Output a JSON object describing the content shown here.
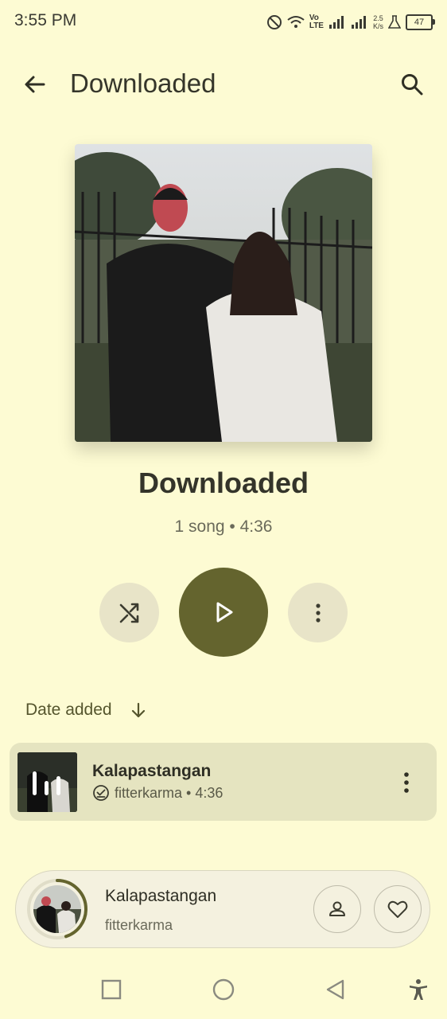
{
  "status_bar": {
    "time": "3:55 PM",
    "network_speed_value": "2.5",
    "network_speed_unit": "K/s",
    "network_label_top": "Vo",
    "network_label_bottom": "LTE",
    "battery": "47"
  },
  "top_bar": {
    "title": "Downloaded",
    "back_icon": "arrow-left-icon",
    "search_icon": "search-icon"
  },
  "playlist": {
    "title": "Downloaded",
    "meta": "1 song • 4:36"
  },
  "controls": {
    "shuffle_icon": "shuffle-icon",
    "play_icon": "play-icon",
    "more_icon": "more-vertical-icon"
  },
  "sort": {
    "label": "Date added",
    "direction_icon": "arrow-down-icon"
  },
  "songs": [
    {
      "title": "Kalapastangan",
      "artist": "fitterkarma",
      "duration": "4:36",
      "subtitle": "fitterkarma • 4:36",
      "downloaded_icon": "download-check-icon",
      "playing_indicator_icon": "equalizer-icon"
    }
  ],
  "mini_player": {
    "title": "Kalapastangan",
    "artist": "fitterkarma",
    "progress": 0.45,
    "artist_icon": "person-icon",
    "like_icon": "heart-icon"
  },
  "colors": {
    "background": "#fdfbd3",
    "accent": "#64642e",
    "secondary_button": "#e8e4c8",
    "row_highlight": "#e5e4c0"
  }
}
